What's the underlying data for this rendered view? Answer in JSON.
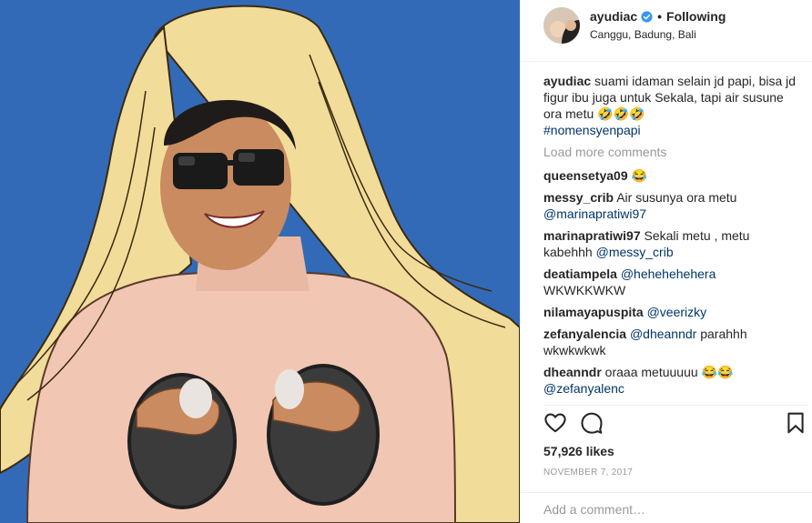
{
  "header": {
    "username": "ayudiac",
    "separator": "•",
    "follow_status": "Following",
    "location": "Canggu, Badung, Bali"
  },
  "caption": {
    "username": "ayudiac",
    "text": "suami idaman selain jd papi, bisa jd figur ibu juga untuk Sekala, tapi air susune ora metu",
    "emoji": "🤣🤣🤣",
    "hashtag": "#nomensyenpapi"
  },
  "load_more_label": "Load more comments",
  "comments": [
    {
      "user": "queensetya09",
      "text": "",
      "mention": "",
      "emoji": "😂",
      "tail": ""
    },
    {
      "user": "messy_crib",
      "text": "Air susunya ora metu",
      "mention": "@marinapratiwi97",
      "emoji": "",
      "tail": ""
    },
    {
      "user": "marinapratiwi97",
      "text": "Sekali metu , metu kabehhh",
      "mention": "@messy_crib",
      "emoji": "",
      "tail": ""
    },
    {
      "user": "deatiampela",
      "text": "",
      "mention": "@hehehehehera",
      "emoji": "",
      "tail": "WKWKKWKW"
    },
    {
      "user": "nilamayapuspita",
      "text": "",
      "mention": "@veerizky",
      "emoji": "",
      "tail": ""
    },
    {
      "user": "zefanyalencia",
      "text": "",
      "mention": "@dheanndr",
      "emoji": "",
      "tail": "parahhh wkwkwkwk"
    },
    {
      "user": "dheanndr",
      "text": "oraaa metuuuuu",
      "mention": "@zefanyalenc",
      "emoji": "😂😂",
      "tail": ""
    }
  ],
  "actions": {
    "icons": [
      "heart-icon",
      "comment-icon",
      "bookmark-icon"
    ]
  },
  "likes": "57,926 likes",
  "date": "NOVEMBER 7, 2017",
  "comment_input": {
    "placeholder": "Add a comment…",
    "value": ""
  },
  "colors": {
    "background_blue": "#2f66b3",
    "hair": "#f2dc9a",
    "skin": "#f1c7b4",
    "mention": "#003569",
    "muted": "#999999"
  }
}
